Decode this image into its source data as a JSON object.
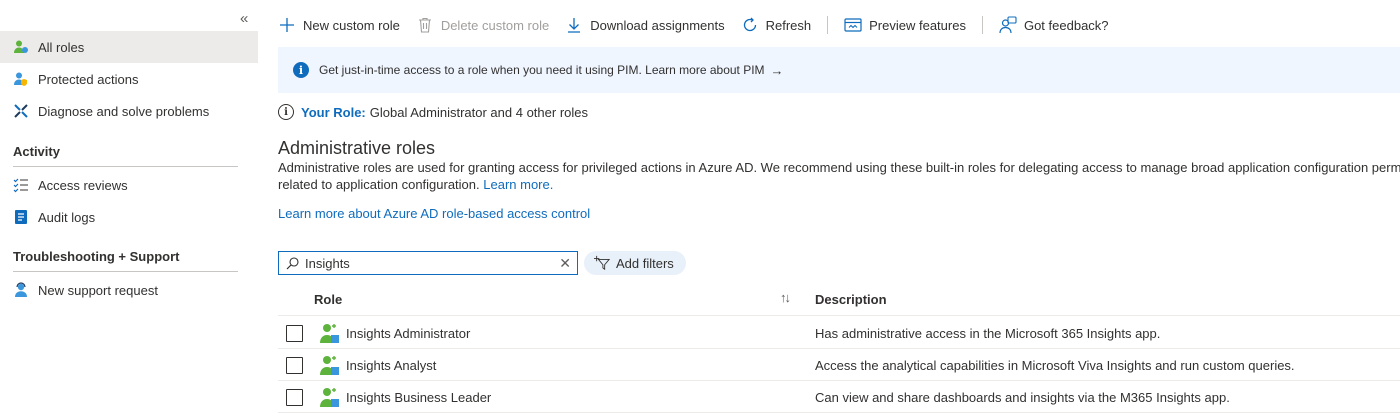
{
  "sidebar": {
    "collapse_glyph": "«",
    "items": [
      {
        "label": "All roles",
        "icon": "all-roles-icon"
      },
      {
        "label": "Protected actions",
        "icon": "protected-actions-icon"
      },
      {
        "label": "Diagnose and solve problems",
        "icon": "wrench-icon"
      }
    ],
    "sections": [
      {
        "title": "Activity",
        "items": [
          {
            "label": "Access reviews",
            "icon": "access-reviews-icon"
          },
          {
            "label": "Audit logs",
            "icon": "audit-logs-icon"
          }
        ]
      },
      {
        "title": "Troubleshooting + Support",
        "items": [
          {
            "label": "New support request",
            "icon": "support-person-icon"
          }
        ]
      }
    ]
  },
  "toolbar": {
    "new_role": "New custom role",
    "delete_role": "Delete custom role",
    "download": "Download assignments",
    "refresh": "Refresh",
    "preview": "Preview features",
    "feedback": "Got feedback?"
  },
  "banner": {
    "text": "Get just-in-time access to a role when you need it using PIM. Learn more about PIM",
    "arrow": "→"
  },
  "your_role": {
    "label": "Your Role:",
    "value": "Global Administrator and 4 other roles"
  },
  "main": {
    "heading": "Administrative roles",
    "description_line1": "Administrative roles are used for granting access for privileged actions in Azure AD. We recommend using these built-in roles for delegating access to manage broad application configuration permissions without granting access to manage other parts of Azure AD not",
    "description_line2": "related to application configuration.",
    "learn_more": "Learn more.",
    "rbac_link": "Learn more about Azure AD role-based access control"
  },
  "search": {
    "value": "Insights",
    "clear": "✕"
  },
  "filters": {
    "label": "Add filters"
  },
  "table": {
    "columns": {
      "role": "Role",
      "sort": "↑↓",
      "description": "Description"
    },
    "rows": [
      {
        "role": "Insights Administrator",
        "description": "Has administrative access in the Microsoft 365 Insights app."
      },
      {
        "role": "Insights Analyst",
        "description": "Access the analytical capabilities in Microsoft Viva Insights and run custom queries."
      },
      {
        "role": "Insights Business Leader",
        "description": "Can view and share dashboards and insights via the M365 Insights app."
      }
    ]
  },
  "colors": {
    "accent": "#0f6cbd",
    "banner_bg": "#f0f6ff",
    "active_nav_bg": "#edebe9",
    "role_icon_green": "#5db33c",
    "role_icon_blue": "#3a96dd"
  }
}
